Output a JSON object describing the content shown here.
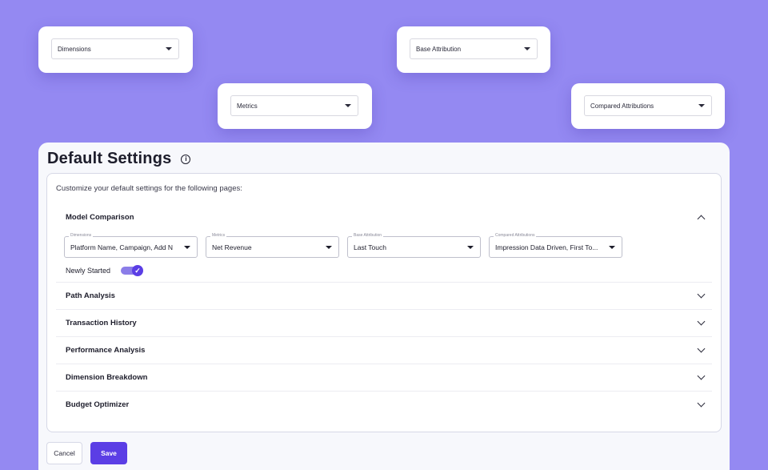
{
  "floating_cards": {
    "dimensions": "Dimensions",
    "base_attribution": "Base Attribution",
    "metrics": "Metrics",
    "compared_attributions": "Compared Attributions"
  },
  "page": {
    "title": "Default Settings",
    "subtitle": "Customize your default settings for the following pages:"
  },
  "sections": [
    {
      "label": "Model Comparison",
      "expanded": true,
      "fields": [
        {
          "legend": "Dimensions",
          "value": "Platform Name, Campaign, Add N"
        },
        {
          "legend": "Metrics",
          "value": "Net Revenue"
        },
        {
          "legend": "Base Attribution",
          "value": "Last Touch"
        },
        {
          "legend": "Compared Attributions",
          "value": "Impression Data Driven, First To..."
        }
      ],
      "toggle": {
        "label": "Newly Started",
        "on": true
      }
    },
    {
      "label": "Path Analysis",
      "expanded": false
    },
    {
      "label": "Transaction History",
      "expanded": false
    },
    {
      "label": "Performance Analysis",
      "expanded": false
    },
    {
      "label": "Dimension Breakdown",
      "expanded": false
    },
    {
      "label": "Budget Optimizer",
      "expanded": false
    }
  ],
  "actions": {
    "cancel": "Cancel",
    "save": "Save"
  },
  "colors": {
    "background": "#9489f2",
    "accent": "#5b3ee5"
  }
}
